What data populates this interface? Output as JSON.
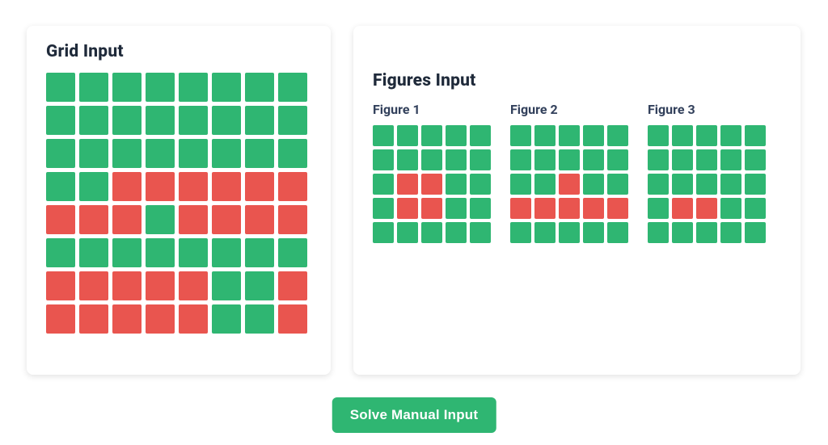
{
  "colors": {
    "green": "#2fb672",
    "red": "#e9554f",
    "text": "#1f2a3a",
    "textMuted": "#33415c"
  },
  "gridPanel": {
    "title": "Grid Input",
    "cols": 8,
    "rows": 8,
    "cells": [
      [
        0,
        0,
        0,
        0,
        0,
        0,
        0,
        0
      ],
      [
        0,
        0,
        0,
        0,
        0,
        0,
        0,
        0
      ],
      [
        0,
        0,
        0,
        0,
        0,
        0,
        0,
        0
      ],
      [
        0,
        0,
        1,
        1,
        1,
        1,
        1,
        1
      ],
      [
        1,
        1,
        1,
        0,
        1,
        1,
        1,
        1
      ],
      [
        0,
        0,
        0,
        0,
        0,
        0,
        0,
        0
      ],
      [
        1,
        1,
        1,
        1,
        1,
        0,
        0,
        1
      ],
      [
        1,
        1,
        1,
        1,
        1,
        0,
        0,
        1
      ]
    ]
  },
  "figuresPanel": {
    "title": "Figures Input",
    "figures": [
      {
        "label": "Figure 1",
        "cols": 5,
        "rows": 5,
        "cells": [
          [
            0,
            0,
            0,
            0,
            0
          ],
          [
            0,
            0,
            0,
            0,
            0
          ],
          [
            0,
            1,
            1,
            0,
            0
          ],
          [
            0,
            1,
            1,
            0,
            0
          ],
          [
            0,
            0,
            0,
            0,
            0
          ]
        ]
      },
      {
        "label": "Figure 2",
        "cols": 5,
        "rows": 5,
        "cells": [
          [
            0,
            0,
            0,
            0,
            0
          ],
          [
            0,
            0,
            0,
            0,
            0
          ],
          [
            0,
            0,
            1,
            0,
            0
          ],
          [
            1,
            1,
            1,
            1,
            1
          ],
          [
            0,
            0,
            0,
            0,
            0
          ]
        ]
      },
      {
        "label": "Figure 3",
        "cols": 5,
        "rows": 5,
        "cells": [
          [
            0,
            0,
            0,
            0,
            0
          ],
          [
            0,
            0,
            0,
            0,
            0
          ],
          [
            0,
            0,
            0,
            0,
            0
          ],
          [
            0,
            1,
            1,
            0,
            0
          ],
          [
            0,
            0,
            0,
            0,
            0
          ]
        ]
      }
    ]
  },
  "solveButton": {
    "label": "Solve Manual Input"
  }
}
